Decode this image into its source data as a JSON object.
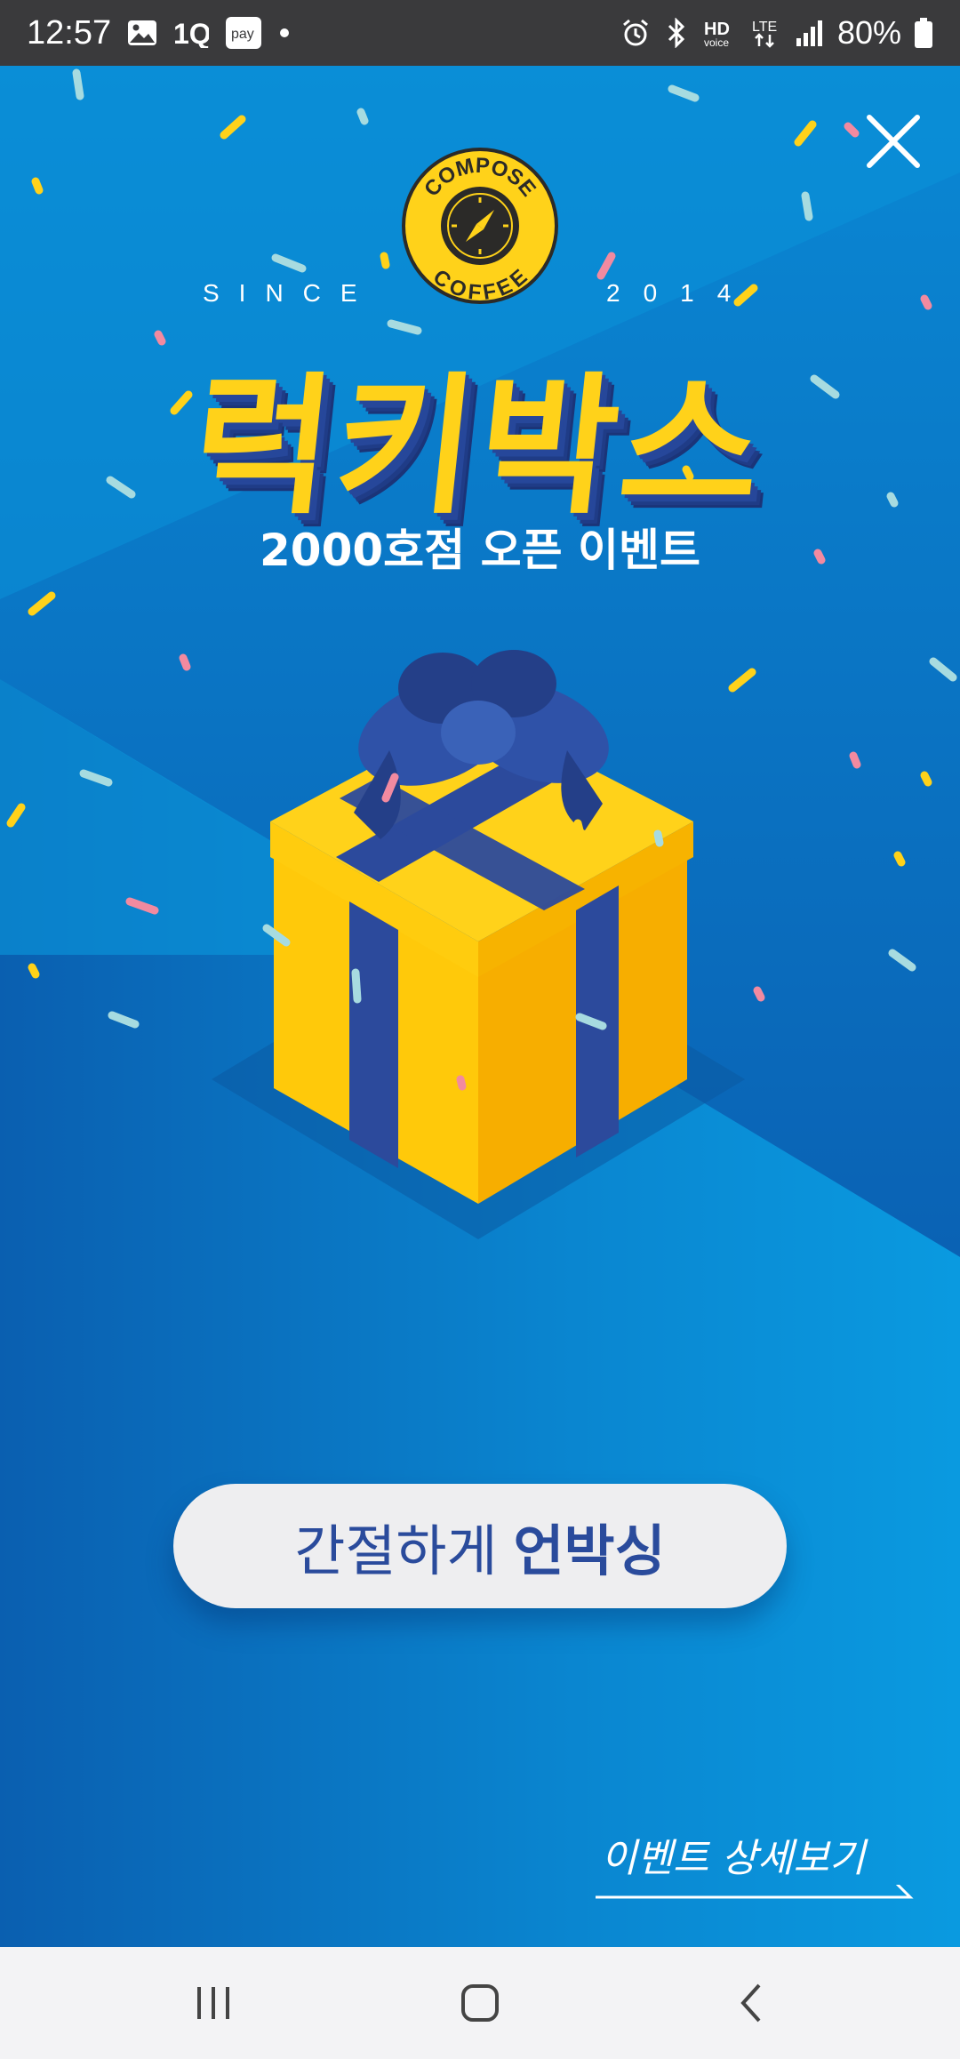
{
  "status_bar": {
    "time": "12:57",
    "icons": [
      "gallery-icon",
      "onestore-icon",
      "pay-icon",
      "dot-icon",
      "alarm-icon",
      "bluetooth-icon",
      "hd-voice-icon",
      "lte-icon",
      "signal-icon",
      "battery-icon"
    ],
    "battery": "80%",
    "hd_label": "HD",
    "voice_label": "voice",
    "lte_label": "LTE",
    "pay_label": "pay"
  },
  "event": {
    "since_left": "SINCE",
    "since_right": "2014",
    "logo_top": "COMPOSE",
    "logo_bottom": "COFFEE",
    "title": "럭키박스",
    "subtitle": "2000호점 오픈 이벤트",
    "unbox_button": {
      "label_regular": "간절하게",
      "label_bold": "언박싱"
    },
    "detail_link": "이벤트 상세보기"
  },
  "colors": {
    "background": "#0a8fd8",
    "title_yellow": "#ffd21a",
    "title_shadow": "#26479a",
    "button_text": "#2a4b9c",
    "button_bg": "#eeeef0"
  }
}
